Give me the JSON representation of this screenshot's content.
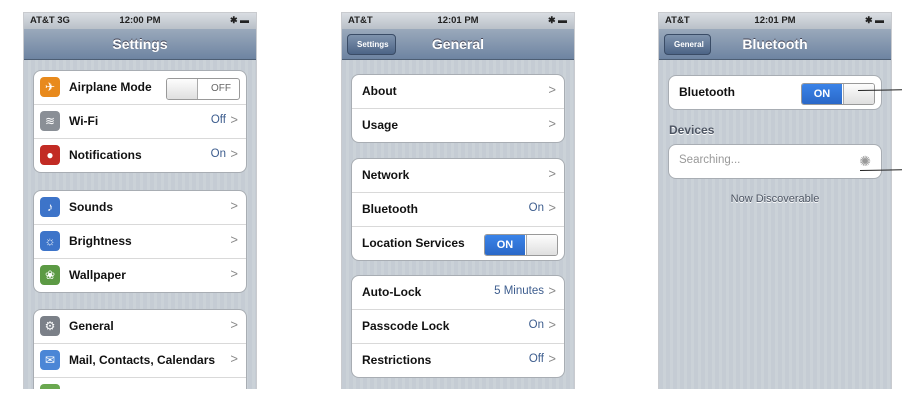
{
  "screen1": {
    "status": {
      "carrier": "AT&T 3G",
      "time": "12:00 PM",
      "battery": "✱ ▬"
    },
    "title": "Settings",
    "group1": [
      {
        "label": "Airplane Mode",
        "toggle": "OFF",
        "icon": "airplane-icon",
        "color": "#e88a1d"
      },
      {
        "label": "Wi-Fi",
        "value": "Off",
        "icon": "wifi-icon",
        "color": "#8a8f96"
      },
      {
        "label": "Notifications",
        "value": "On",
        "icon": "notifications-icon",
        "color": "#c22b24"
      }
    ],
    "group2": [
      {
        "label": "Sounds",
        "icon": "sounds-icon",
        "color": "#3d74c9"
      },
      {
        "label": "Brightness",
        "icon": "brightness-icon",
        "color": "#3d74c9"
      },
      {
        "label": "Wallpaper",
        "icon": "wallpaper-icon",
        "color": "#5c9a44"
      }
    ],
    "group3": [
      {
        "label": "General",
        "icon": "gear-icon",
        "color": "#7b8088"
      },
      {
        "label": "Mail, Contacts, Calendars",
        "icon": "mail-icon",
        "color": "#4b86d6"
      }
    ]
  },
  "screen2": {
    "status": {
      "carrier": "AT&T",
      "time": "12:01 PM",
      "battery": "✱ ▬"
    },
    "back": "Settings",
    "title": "General",
    "group1": [
      {
        "label": "About"
      },
      {
        "label": "Usage"
      }
    ],
    "group2": [
      {
        "label": "Network"
      },
      {
        "label": "Bluetooth",
        "value": "On"
      },
      {
        "label": "Location Services",
        "toggle": "ON"
      }
    ],
    "group3": [
      {
        "label": "Auto-Lock",
        "value": "5 Minutes"
      },
      {
        "label": "Passcode Lock",
        "value": "On"
      },
      {
        "label": "Restrictions",
        "value": "Off"
      }
    ]
  },
  "screen3": {
    "status": {
      "carrier": "AT&T",
      "time": "12:01 PM",
      "battery": "✱ ▬"
    },
    "back": "General",
    "title": "Bluetooth",
    "bluetooth_label": "Bluetooth",
    "bluetooth_toggle": "ON",
    "devices_header": "Devices",
    "searching": "Searching...",
    "discoverable": "Now Discoverable"
  },
  "chevron": ">"
}
